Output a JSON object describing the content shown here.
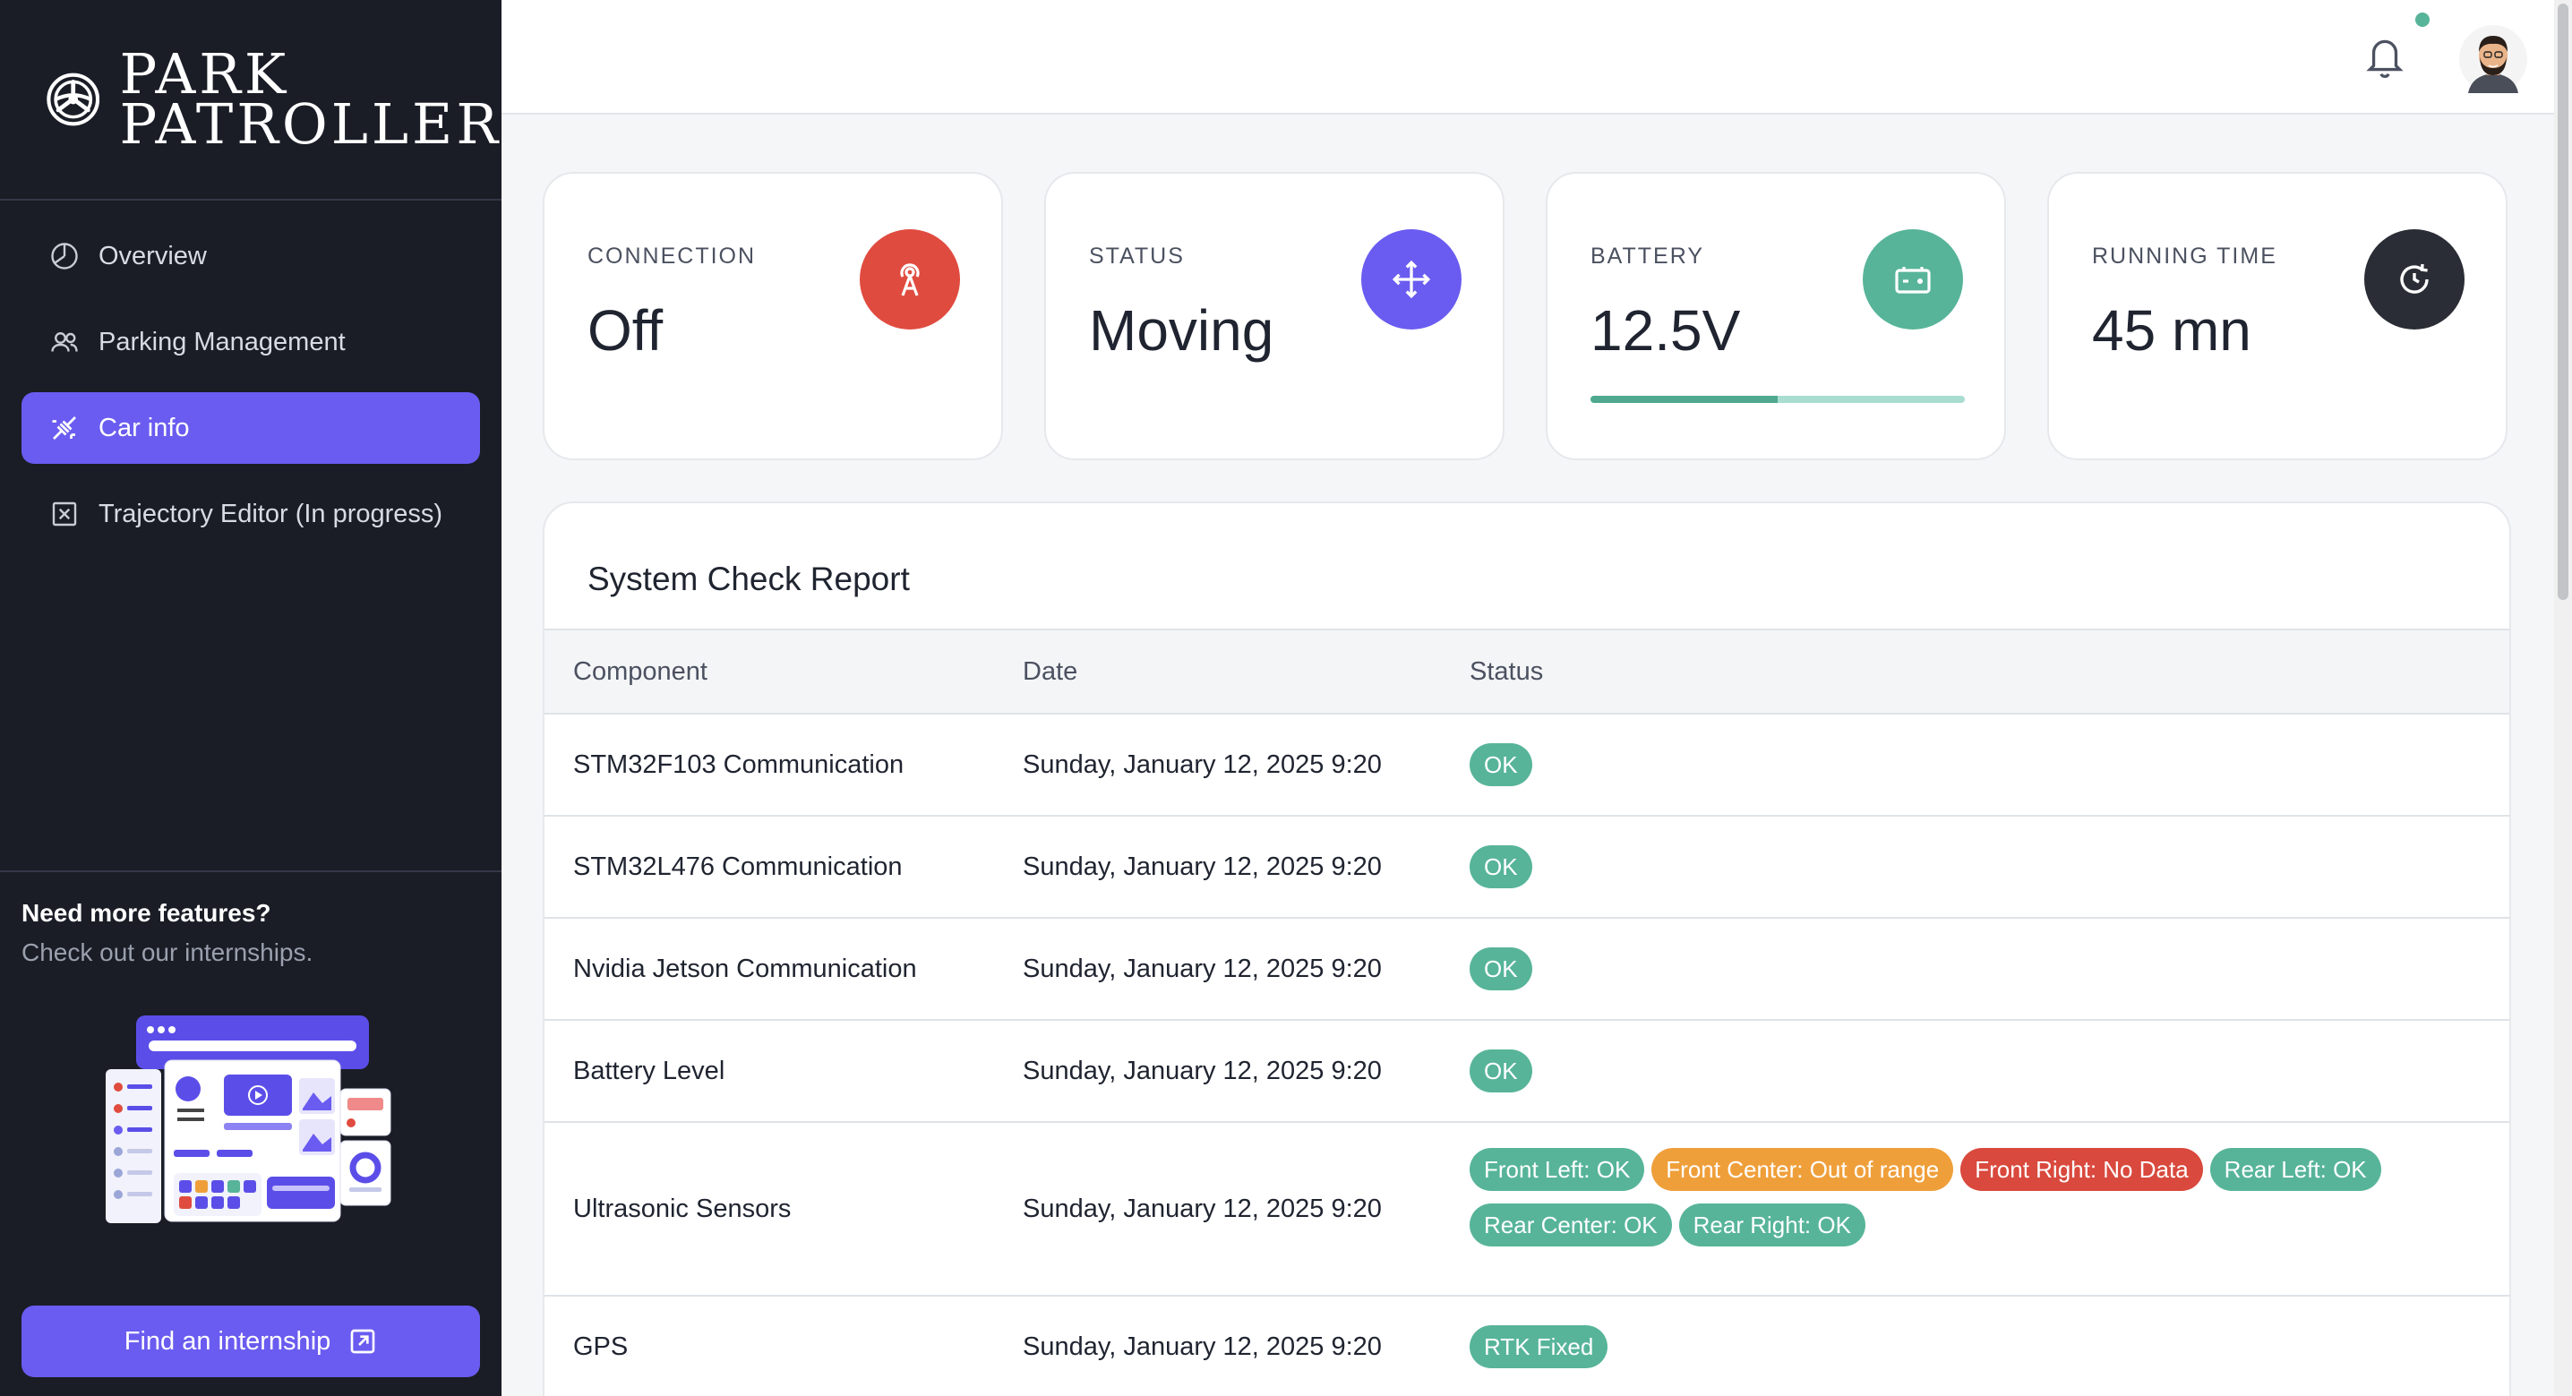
{
  "brand": {
    "line1": "PARK",
    "line2": "PATROLLER"
  },
  "sidebar": {
    "items": [
      {
        "label": "Overview",
        "icon": "overview-icon",
        "active": false
      },
      {
        "label": "Parking Management",
        "icon": "users-icon",
        "active": false
      },
      {
        "label": "Car info",
        "icon": "car-info-icon",
        "active": true
      },
      {
        "label": "Trajectory Editor (In progress)",
        "icon": "trajectory-icon",
        "active": false
      }
    ],
    "promo": {
      "title": "Need more features?",
      "subtitle": "Check out our internships.",
      "button_label": "Find an internship"
    }
  },
  "header": {
    "notification_icon": "bell-icon",
    "has_unread": true,
    "avatar": "user-avatar"
  },
  "cards": {
    "connection": {
      "label": "CONNECTION",
      "value": "Off",
      "icon": "broadcast-icon",
      "color": "#e04b3f"
    },
    "status": {
      "label": "STATUS",
      "value": "Moving",
      "icon": "move-arrows-icon",
      "color": "#6a5cf0"
    },
    "battery": {
      "label": "BATTERY",
      "value": "12.5V",
      "icon": "battery-icon",
      "color": "#57b499",
      "level_fraction": 0.5
    },
    "running_time": {
      "label": "RUNNING TIME",
      "value": "45 mn",
      "icon": "refresh-icon",
      "color": "#2a2d35"
    }
  },
  "report": {
    "title": "System Check Report",
    "columns": [
      "Component",
      "Date",
      "Status"
    ],
    "rows": [
      {
        "component": "STM32F103 Communication",
        "date": "Sunday, January 12, 2025 9:20",
        "badges": [
          {
            "text": "OK",
            "kind": "ok"
          }
        ]
      },
      {
        "component": "STM32L476 Communication",
        "date": "Sunday, January 12, 2025 9:20",
        "badges": [
          {
            "text": "OK",
            "kind": "ok"
          }
        ]
      },
      {
        "component": "Nvidia Jetson Communication",
        "date": "Sunday, January 12, 2025 9:20",
        "badges": [
          {
            "text": "OK",
            "kind": "ok"
          }
        ]
      },
      {
        "component": "Battery Level",
        "date": "Sunday, January 12, 2025 9:20",
        "badges": [
          {
            "text": "OK",
            "kind": "ok"
          }
        ]
      },
      {
        "component": "Ultrasonic Sensors",
        "date": "Sunday, January 12, 2025 9:20",
        "badges": [
          {
            "text": "Front Left: OK",
            "kind": "ok"
          },
          {
            "text": "Front Center: Out of range",
            "kind": "warn"
          },
          {
            "text": "Front Right: No Data",
            "kind": "err"
          },
          {
            "text": "Rear Left: OK",
            "kind": "ok"
          },
          {
            "text": "Rear Center: OK",
            "kind": "ok"
          },
          {
            "text": "Rear Right: OK",
            "kind": "ok"
          }
        ]
      },
      {
        "component": "GPS",
        "date": "Sunday, January 12, 2025 9:20",
        "badges": [
          {
            "text": "RTK Fixed",
            "kind": "ok"
          }
        ]
      }
    ]
  }
}
